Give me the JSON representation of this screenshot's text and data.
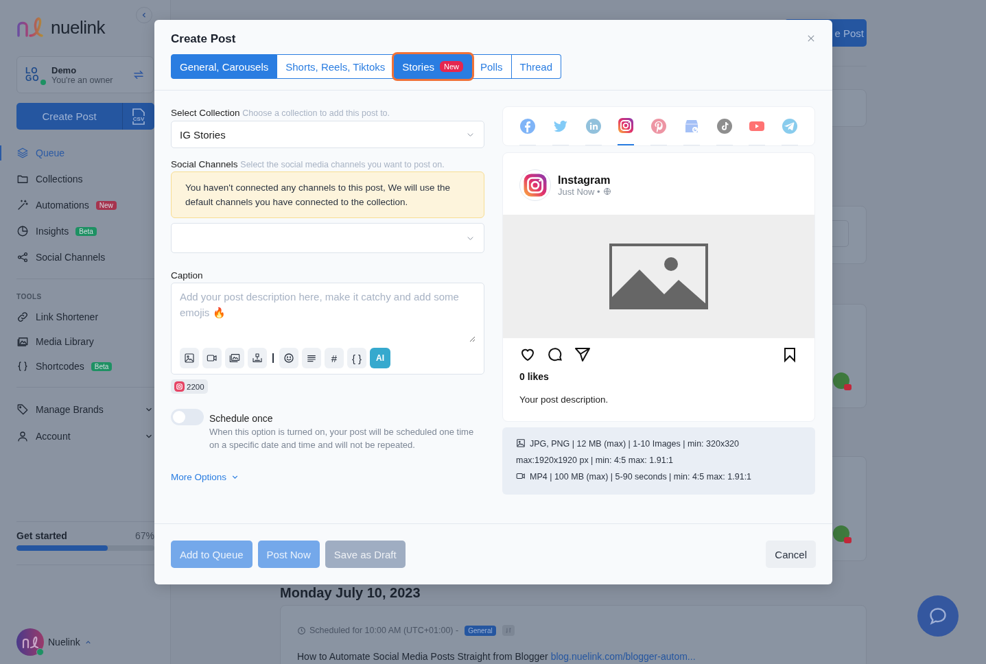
{
  "sidebar": {
    "logo_text": "nuelink",
    "brand": {
      "name": "Demo",
      "role": "You're an owner",
      "logo_lines": [
        "LO",
        "GO"
      ]
    },
    "create_button": "Create Post",
    "csv_label": "CSV",
    "nav": [
      {
        "label": "Queue",
        "selected": true
      },
      {
        "label": "Collections",
        "selected": false
      },
      {
        "label": "Automations",
        "selected": false,
        "badge": {
          "text": "New",
          "color": "#a6344e"
        }
      },
      {
        "label": "Insights",
        "selected": false,
        "badge": {
          "text": "Beta",
          "color": "#1e9163"
        }
      },
      {
        "label": "Social Channels",
        "selected": false
      }
    ],
    "tools_heading": "TOOLS",
    "tools": [
      {
        "label": "Link Shortener",
        "selected": false
      },
      {
        "label": "Media Library",
        "selected": false
      },
      {
        "label": "Shortcodes",
        "selected": false,
        "badge": {
          "text": "Beta",
          "color": "#1e9163"
        }
      }
    ],
    "menus": [
      {
        "label": "Manage Brands",
        "expanded": false
      },
      {
        "label": "Account",
        "expanded": false
      }
    ],
    "progress": {
      "label": "Get started",
      "reading": "67%",
      "level": 0.66
    },
    "user": {
      "name": "Nuelink",
      "expanded": true
    }
  },
  "background": {
    "top_button": "e Post",
    "date_heading": "Monday July 10, 2023",
    "post": {
      "schedule": "Scheduled for 10:00 AM (UTC+01:00) -",
      "tag": "General",
      "text": "How to Automate Social Media Posts Straight from Blogger",
      "link": "blog.nuelink.com/blogger-autom..."
    }
  },
  "modal": {
    "title": "Create Post",
    "tabs": [
      {
        "label": "General, Carousels",
        "selected": true,
        "highlighted": false
      },
      {
        "label": "Shorts, Reels, Tiktoks",
        "selected": false,
        "highlighted": false
      },
      {
        "label": "Stories",
        "selected": true,
        "highlighted": true,
        "badge": "New"
      },
      {
        "label": "Polls",
        "selected": false,
        "highlighted": false
      },
      {
        "label": "Thread",
        "selected": false,
        "highlighted": false
      }
    ],
    "collection": {
      "label": "Select Collection",
      "hint": "Choose a collection to add this post to.",
      "value": "IG Stories"
    },
    "channels": {
      "label": "Social Channels",
      "hint": "Select the social media channels you want to post on.",
      "warning": "You haven't connected any channels to this post, We will use the default channels you have connected to the collection."
    },
    "caption": {
      "label": "Caption",
      "placeholder": "Add your post description here, make it catchy and add some emojis 🔥",
      "tools": [
        {
          "kind": "image"
        },
        {
          "kind": "video"
        },
        {
          "kind": "gallery"
        },
        {
          "kind": "upload"
        },
        {
          "kind": "separator"
        },
        {
          "kind": "emoji"
        },
        {
          "kind": "align"
        },
        {
          "kind": "text",
          "text": "#"
        },
        {
          "kind": "text",
          "text": "{ }"
        },
        {
          "kind": "ai",
          "text": "AI"
        }
      ],
      "char_count": "2200"
    },
    "schedule": {
      "label": "Schedule once",
      "description": "When this option is turned on, your post will be scheduled one time on a specific date and time and will not be repeated.",
      "on": false
    },
    "more_options": "More Options",
    "buttons": [
      {
        "label": "Add to Queue",
        "kind": "primary",
        "disabled": true
      },
      {
        "label": "Post Now",
        "kind": "primary",
        "disabled": true
      },
      {
        "label": "Save as Draft",
        "kind": "secondary",
        "disabled": true
      }
    ],
    "cancel": "Cancel",
    "preview": {
      "networks": [
        {
          "kind": "facebook",
          "selected": false
        },
        {
          "kind": "twitter",
          "selected": false
        },
        {
          "kind": "linkedin",
          "selected": false
        },
        {
          "kind": "instagram",
          "selected": true
        },
        {
          "kind": "pinterest",
          "selected": false
        },
        {
          "kind": "business",
          "selected": false
        },
        {
          "kind": "tiktok",
          "selected": false
        },
        {
          "kind": "youtube",
          "selected": false
        },
        {
          "kind": "telegram",
          "selected": false
        }
      ],
      "account": "Instagram",
      "time": "Just Now •",
      "likes": "0 likes",
      "description": "Your post description.",
      "specs": [
        {
          "kind": "image",
          "text": "JPG, PNG | 12 MB (max) | 1-10 Images | min: 320x320 max:1920x1920 px | min: 4:5 max: 1.91:1"
        },
        {
          "kind": "video",
          "text": "MP4 | 100 MB (max) | 5-90 seconds | min: 4:5 max: 1.91:1"
        }
      ]
    }
  }
}
